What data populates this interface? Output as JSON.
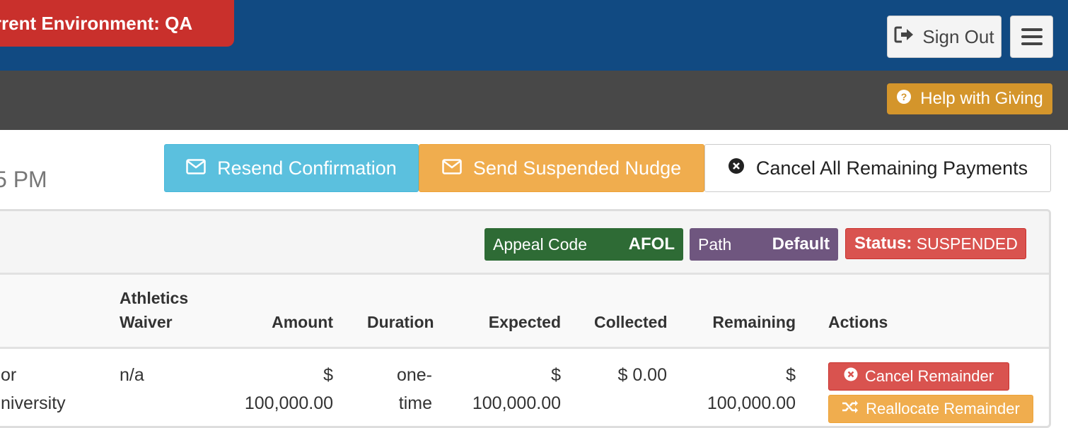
{
  "header": {
    "environment_banner": "urrent Environment: QA",
    "sign_out_label": "Sign Out"
  },
  "subheader": {
    "help_label": "Help with Giving"
  },
  "page": {
    "date_fragment": "5 PM"
  },
  "actions": {
    "resend_label": "Resend Confirmation",
    "nudge_label": "Send Suspended Nudge",
    "cancel_all_label": "Cancel All Remaining Payments"
  },
  "labels": {
    "appeal_key": "Appeal Code",
    "appeal_value": "AFOL",
    "path_key": "Path",
    "path_value": "Default",
    "status_key": "Status:",
    "status_value": "SUSPENDED"
  },
  "table": {
    "headers": {
      "waiver_line1": "Athletics",
      "waiver_line2": "Waiver",
      "amount": "Amount",
      "duration": "Duration",
      "expected": "Expected",
      "collected": "Collected",
      "remaining": "Remaining",
      "actions": "Actions"
    },
    "row": {
      "name_line1": "or",
      "name_line2": "niversity",
      "waiver": "n/a",
      "amount_line1": "$",
      "amount_line2": "100,000.00",
      "duration_line1": "one-",
      "duration_line2": "time",
      "expected_line1": "$",
      "expected_line2": "100,000.00",
      "collected": "$ 0.00",
      "remaining_line1": "$",
      "remaining_line2": "100,000.00",
      "cancel_remainder_label": "Cancel Remainder",
      "reallocate_remainder_label": "Reallocate Remainder"
    }
  },
  "colors": {
    "topbar": "#114a82",
    "env_banner": "#c9302c",
    "subbar": "#484848",
    "help": "#d4952b",
    "info": "#5bc0de",
    "warning": "#f0ad4e",
    "danger": "#d9534f",
    "appeal": "#2e6b35",
    "path": "#6f567f"
  }
}
